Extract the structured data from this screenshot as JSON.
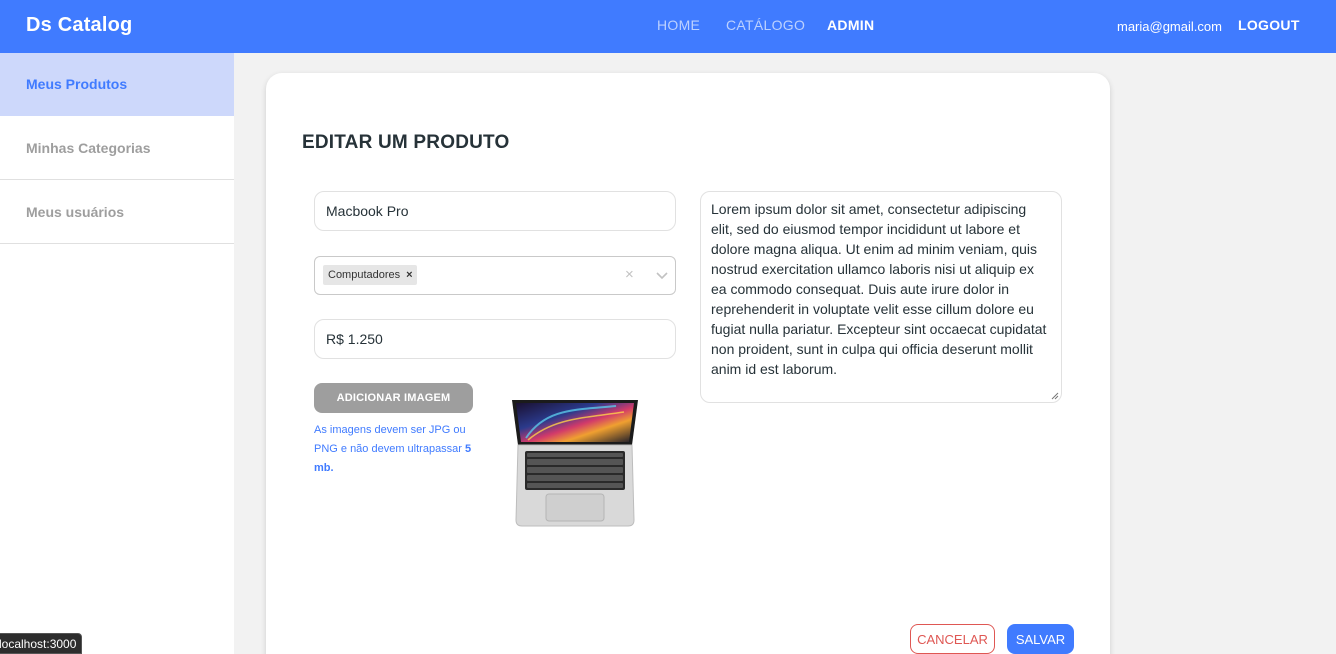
{
  "navbar": {
    "brand": "Ds Catalog",
    "links": {
      "home": "HOME",
      "catalogo": "CATÁLOGO",
      "admin": "ADMIN"
    },
    "user_email": "maria@gmail.com",
    "logout": "LOGOUT",
    "accent_color": "#407bff"
  },
  "sidebar": {
    "items": [
      {
        "label": "Meus Produtos",
        "active": true
      },
      {
        "label": "Minhas Categorias",
        "active": false
      },
      {
        "label": "Meus usuários",
        "active": false
      }
    ]
  },
  "form": {
    "title": "EDITAR UM PRODUTO",
    "name_value": "Macbook Pro",
    "category_chip": "Computadores",
    "price_value": "R$ 1.250",
    "add_image_label": "ADICIONAR IMAGEM",
    "image_hint_text": "As imagens devem ser JPG ou PNG e não devem ultrapassar ",
    "image_hint_bold": "5 mb.",
    "description": "Lorem ipsum dolor sit amet, consectetur adipiscing elit, sed do eiusmod tempor incididunt ut labore et dolore magna aliqua. Ut enim ad minim veniam, quis nostrud exercitation ullamco laboris nisi ut aliquip ex ea commodo consequat. Duis aute irure dolor in reprehenderit in voluptate velit esse cillum dolore eu fugiat nulla pariatur. Excepteur sint occaecat cupidatat non proident, sunt in culpa qui officia deserunt mollit anim id est laborum.",
    "cancel_label": "CANCELAR",
    "save_label": "SALVAR",
    "product_image_icon": "laptop-image"
  },
  "status_bar": {
    "url": "localhost:3000"
  }
}
